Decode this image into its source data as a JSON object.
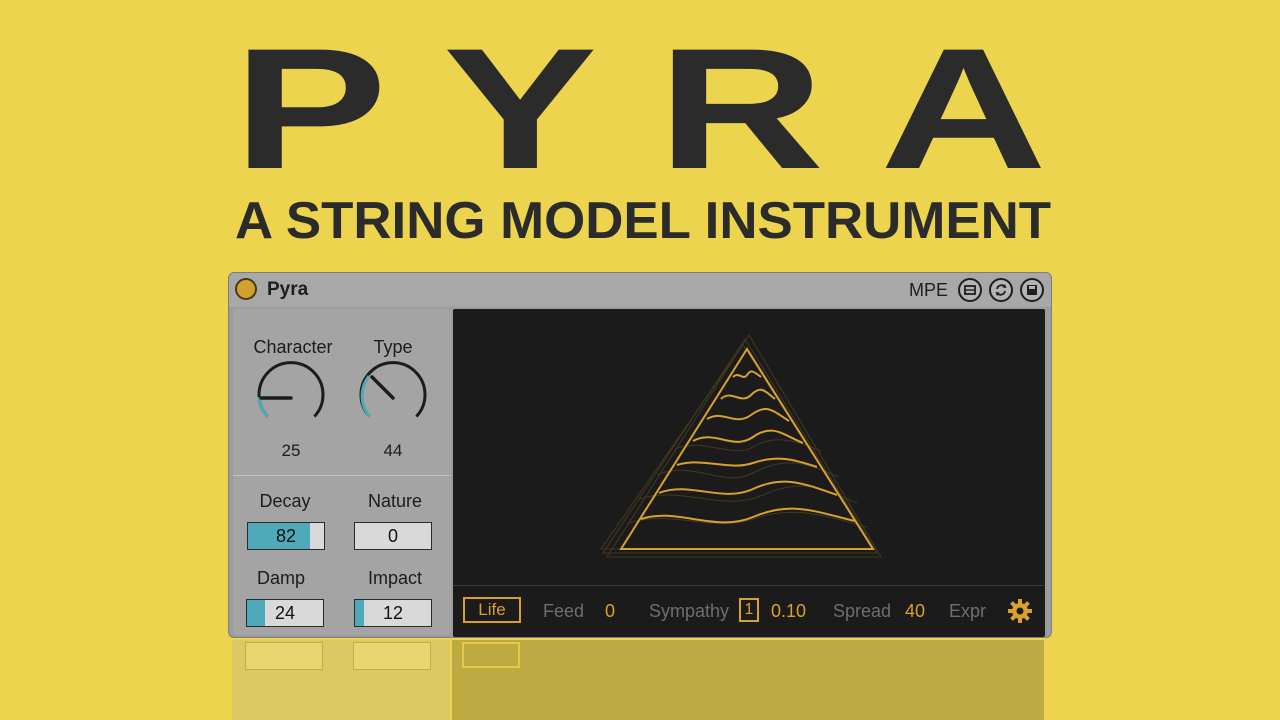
{
  "hero": {
    "title": "P Y R A",
    "subtitle": "A STRING MODEL INSTRUMENT"
  },
  "device": {
    "name": "Pyra",
    "mpe_label": "MPE",
    "toolbar_icons": [
      "hot-swap-icon",
      "refresh-icon",
      "save-icon"
    ],
    "knobs": [
      {
        "label": "Character",
        "value": "25",
        "level": 0.25
      },
      {
        "label": "Type",
        "value": "44",
        "level": 0.44
      }
    ],
    "numboxes": [
      {
        "label": "Decay",
        "value": "82",
        "level": 0.82
      },
      {
        "label": "Nature",
        "value": "0",
        "level": 0.0
      },
      {
        "label": "Damp",
        "value": "24",
        "level": 0.24
      },
      {
        "label": "Impact",
        "value": "12",
        "level": 0.12
      }
    ],
    "bottom_bar": {
      "life": "Life",
      "feed_label": "Feed",
      "feed_value": "0",
      "sympathy_label": "Sympathy",
      "sympathy_box": "1",
      "sympathy_value": "0.10",
      "spread_label": "Spread",
      "spread_value": "40",
      "expr_label": "Expr"
    }
  },
  "colors": {
    "background": "#edd44f",
    "accent_gold": "#d7a02f",
    "accent_teal": "#4eaab9",
    "panel": "#9c9c9c",
    "display_bg": "#1b1b1b"
  }
}
